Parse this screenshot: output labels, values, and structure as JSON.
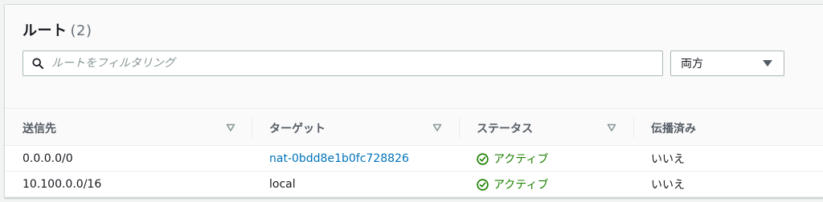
{
  "routes_panel": {
    "title": "ルート",
    "count": "(2)",
    "search": {
      "placeholder": "ルートをフィルタリング",
      "value": ""
    },
    "filter_select": {
      "value": "両方"
    },
    "columns": [
      {
        "label": "送信先",
        "sort_icon": "sort-caret-icon"
      },
      {
        "label": "ターゲット",
        "sort_icon": "sort-caret-icon"
      },
      {
        "label": "ステータス",
        "sort_icon": "sort-caret-icon"
      },
      {
        "label": "伝播済み"
      }
    ],
    "rows": [
      {
        "destination": "0.0.0.0/0",
        "target": "nat-0bdd8e1b0fc728826",
        "target_is_link": true,
        "status": "アクティブ",
        "propagated": "いいえ"
      },
      {
        "destination": "10.100.0.0/16",
        "target": "local",
        "target_is_link": false,
        "status": "アクティブ",
        "propagated": "いいえ"
      }
    ]
  },
  "colors": {
    "link": "#0073bb",
    "success": "#1d8102",
    "header_text": "#545b64"
  }
}
